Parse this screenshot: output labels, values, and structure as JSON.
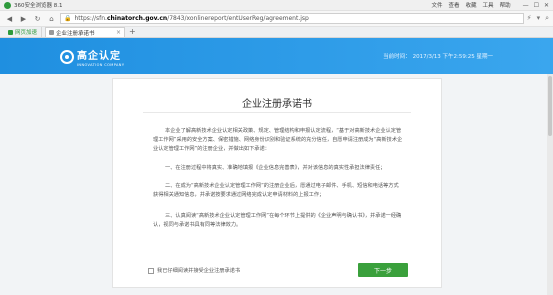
{
  "browser": {
    "title": "360安全浏览器 8.1",
    "menus": [
      "文件",
      "查看",
      "收藏",
      "工具",
      "帮助"
    ],
    "url_prefix": "https://sfn.",
    "url_domain": "chinatorch.gov.cn",
    "url_suffix": "/7843/xonlinereport/entUserReg/agreement.jsp",
    "favorite_label": "网页加速",
    "tab_label": "企业注册承诺书",
    "new_tab_symbol": "+"
  },
  "header": {
    "brand_name": "高企认定",
    "brand_sub": "INNOVATION COMPANY",
    "time_label": "当前时间：",
    "time_value": "2017/3/13 下午2:59:25 星期一"
  },
  "card": {
    "title": "企业注册承诺书",
    "p1": "本企业了解高新技术企业认定相关政策、规定、管理结构和申报认定流程，“基于对高新技术企业认定管理工作网”采用的安全方案、保密措施、网络身份识别和验证系统的充分信任，自愿申请注册成为“高新技术企业认定管理工作网”的注册企业，并做出如下承诺：",
    "p2": "一、在注册过程中将真实、准确地填报《企业信息完善表》，并对该信息的真实性承担法律责任；",
    "p3": "二、在成为“高新技术企业认定管理工作网”的注册企业后，愿通过电子邮件、手机、短信和电话等方式获得相关通知信息，并承诺按要求通过网络完成认定申请材料的上报工作；",
    "p4": "三、认真阅读“高新技术企业认定管理工作网”在每个环节上提供的《企业声明与确认书》，并承诺一经确认，视同与承诺书具有同等法律效力。",
    "agree_label": "我已仔细阅读并接受企业注册承诺书",
    "next_label": "下一步"
  }
}
